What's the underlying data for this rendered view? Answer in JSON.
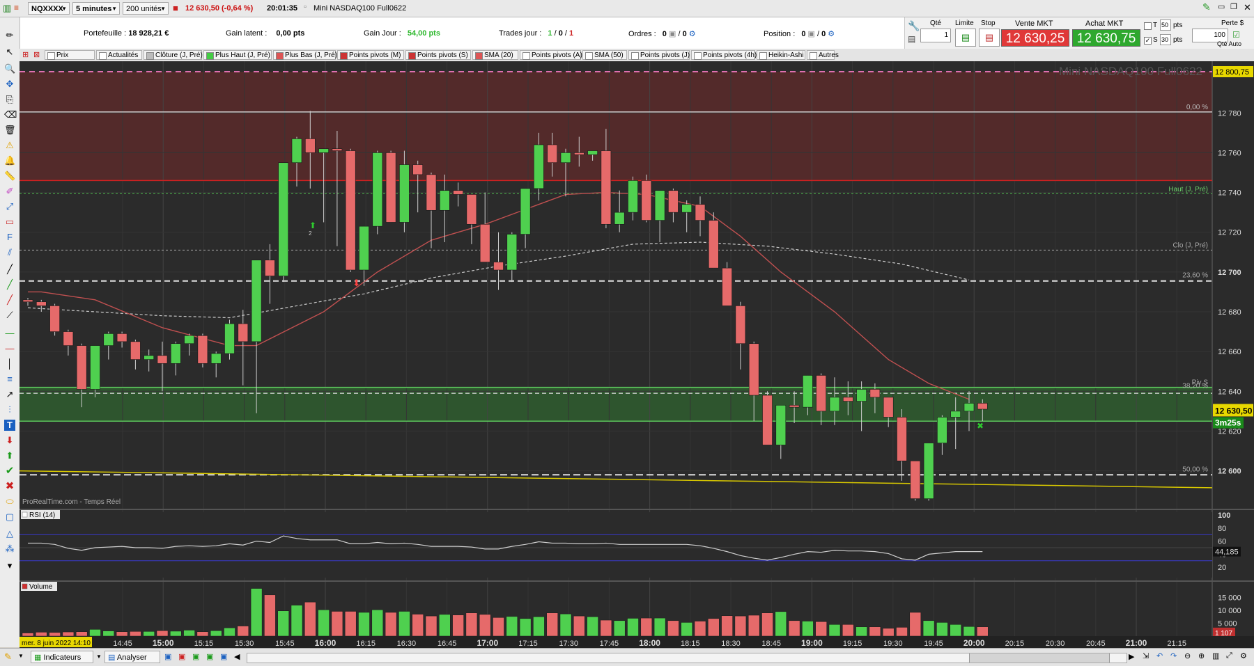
{
  "topbar": {
    "symbol": "NQXXXX",
    "timeframe": "5 minutes",
    "units": "200 unités",
    "price_change": "12 630,50 (-0,64 %)",
    "time": "20:01:35",
    "instrument": "Mini NASDAQ100 Full0622"
  },
  "info": {
    "portefeuille_label": "Portefeuille :",
    "portefeuille_value": "18 928,21 €",
    "gain_latent_label": "Gain latent :",
    "gain_latent_value": "0,00 pts",
    "gain_jour_label": "Gain Jour :",
    "gain_jour_value": "54,00 pts",
    "trades_label": "Trades jour :",
    "trades_a": "1",
    "trades_b": "0",
    "trades_c": "1",
    "ordres_label": "Ordres :",
    "ordres_a": "0",
    "ordres_b": "0",
    "position_label": "Position :",
    "position_a": "0",
    "position_b": "0"
  },
  "order": {
    "qte_label": "Qté",
    "qte_value": "1",
    "limite_label": "Limite",
    "stop_label": "Stop",
    "vente_label": "Vente MKT",
    "vente_price": "12 630,25",
    "achat_label": "Achat MKT",
    "achat_price": "12 630,75",
    "t_label": "T",
    "t_value": "50",
    "t_unit": "pts",
    "s_label": "S",
    "s_value": "30",
    "s_unit": "pts",
    "perte_label": "Perte $",
    "perte_value": "100",
    "qte_auto_label": "Qté Auto"
  },
  "indicators": [
    "Prix",
    "Actualités",
    "Clôture (J, Pré)",
    "Plus Haut (J, Pré)",
    "Plus Bas (J, Pré)",
    "Points pivots (M)",
    "Points pivots (S)",
    "SMA (20)",
    "Points pivots (A)",
    "SMA (50)",
    "Points pivots (J)",
    "Points pivots (4h)",
    "Heikin-Ashi",
    "Autres"
  ],
  "indicator_colors": [
    "#ffffff",
    "#ffffff",
    "#bbbbbb",
    "#44cc44",
    "#dd5555",
    "#cc3333",
    "#cc3333",
    "#dd5555",
    "#ffffff",
    "#ffffff",
    "#ffffff",
    "#ffffff",
    "#ffffff",
    "#ffffff"
  ],
  "chart": {
    "watermark": "Mini NASDAQ100 Full0622",
    "source": "ProRealTime.com - Temps Réel",
    "rsi_label": "RSI (14)",
    "volume_label": "Volume",
    "current_price": "12 630,50",
    "countdown": "3m25s",
    "top_price": "12 800,75",
    "rsi_value": "44,185",
    "volume_value": "1 107",
    "date_label": "mer. 8 juin 2022 14:10",
    "fib_labels": {
      "f0": "0,00 %",
      "f236": "23,60 %",
      "f382": "38,20 %",
      "f50": "50,00 %"
    },
    "level_labels": {
      "haut": "Haut (J, Pré)",
      "clo": "Clo (J, Pré)",
      "piv": "Piv S"
    },
    "marker_label": "2"
  },
  "chart_data": {
    "type": "candlestick",
    "y_ticks": [
      12780,
      12760,
      12740,
      12720,
      12700,
      12680,
      12660,
      12640,
      12620,
      12600
    ],
    "y_tick_labels": [
      "12 780",
      "12 760",
      "12 740",
      "12 720",
      "12 700",
      "12 680",
      "12 660",
      "12 640",
      "12 620",
      "12 600"
    ],
    "ylim": [
      12582,
      12806
    ],
    "x_tick_labels": [
      "14:45",
      "15:00",
      "15:15",
      "15:30",
      "15:45",
      "16:00",
      "16:15",
      "16:30",
      "16:45",
      "17:00",
      "17:15",
      "17:30",
      "17:45",
      "18:00",
      "18:15",
      "18:30",
      "18:45",
      "19:00",
      "19:15",
      "19:30",
      "19:45",
      "20:00",
      "20:15",
      "20:30",
      "20:45",
      "21:00",
      "21:15"
    ],
    "x_tick_bold": [
      "15:00",
      "16:00",
      "17:00",
      "18:00",
      "19:00",
      "20:00",
      "21:00"
    ],
    "candles": [
      [
        12686,
        12687,
        12683,
        12685
      ],
      [
        12685,
        12686,
        12680,
        12683
      ],
      [
        12683,
        12684,
        12668,
        12670
      ],
      [
        12670,
        12671,
        12658,
        12663
      ],
      [
        12663,
        12664,
        12632,
        12641
      ],
      [
        12641,
        12663,
        12637,
        12663
      ],
      [
        12663,
        12670,
        12656,
        12669
      ],
      [
        12669,
        12670,
        12662,
        12665
      ],
      [
        12665,
        12666,
        12651,
        12656
      ],
      [
        12656,
        12661,
        12650,
        12658
      ],
      [
        12658,
        12665,
        12640,
        12654
      ],
      [
        12654,
        12665,
        12648,
        12664
      ],
      [
        12664,
        12669,
        12658,
        12668
      ],
      [
        12668,
        12669,
        12652,
        12654
      ],
      [
        12654,
        12660,
        12647,
        12659
      ],
      [
        12659,
        12676,
        12656,
        12674
      ],
      [
        12674,
        12681,
        12643,
        12665
      ],
      [
        12665,
        12706,
        12629,
        12706
      ],
      [
        12706,
        12714,
        12684,
        12698
      ],
      [
        12698,
        12755,
        12695,
        12755
      ],
      [
        12755,
        12768,
        12743,
        12767
      ],
      [
        12767,
        12781,
        12742,
        12760
      ],
      [
        12760,
        12762,
        12725,
        12762
      ],
      [
        12762,
        12771,
        12713,
        12761
      ],
      [
        12761,
        12762,
        12700,
        12701
      ],
      [
        12701,
        12723,
        12693,
        12723
      ],
      [
        12723,
        12761,
        12719,
        12760
      ],
      [
        12760,
        12761,
        12725,
        12725
      ],
      [
        12725,
        12761,
        12720,
        12754
      ],
      [
        12754,
        12756,
        12730,
        12749
      ],
      [
        12749,
        12750,
        12712,
        12731
      ],
      [
        12731,
        12749,
        12715,
        12741
      ],
      [
        12741,
        12745,
        12733,
        12739
      ],
      [
        12739,
        12739,
        12714,
        12724
      ],
      [
        12724,
        12740,
        12710,
        12705
      ],
      [
        12705,
        12720,
        12691,
        12701
      ],
      [
        12701,
        12720,
        12695,
        12719
      ],
      [
        12719,
        12742,
        12712,
        12742
      ],
      [
        12742,
        12770,
        12736,
        12764
      ],
      [
        12764,
        12770,
        12748,
        12755
      ],
      [
        12755,
        12762,
        12738,
        12760
      ],
      [
        12760,
        12768,
        12753,
        12759
      ],
      [
        12759,
        12760,
        12756,
        12761
      ],
      [
        12761,
        12772,
        12722,
        12724
      ],
      [
        12724,
        12741,
        12720,
        12730
      ],
      [
        12730,
        12748,
        12726,
        12746
      ],
      [
        12746,
        12749,
        12725,
        12726
      ],
      [
        12726,
        12741,
        12715,
        12741
      ],
      [
        12741,
        12742,
        12725,
        12730
      ],
      [
        12730,
        12736,
        12720,
        12734
      ],
      [
        12734,
        12738,
        12718,
        12726
      ],
      [
        12726,
        12730,
        12702,
        12702
      ],
      [
        12702,
        12705,
        12684,
        12683
      ],
      [
        12683,
        12685,
        12651,
        12664
      ],
      [
        12664,
        12665,
        12625,
        12638
      ],
      [
        12638,
        12640,
        12619,
        12613
      ],
      [
        12613,
        12633,
        12606,
        12633
      ],
      [
        12633,
        12640,
        12624,
        12632
      ],
      [
        12632,
        12648,
        12628,
        12648
      ],
      [
        12648,
        12649,
        12623,
        12630
      ],
      [
        12630,
        12647,
        12623,
        12637
      ],
      [
        12637,
        12645,
        12628,
        12635
      ],
      [
        12635,
        12645,
        12620,
        12641
      ],
      [
        12641,
        12644,
        12629,
        12637
      ],
      [
        12637,
        12637,
        12622,
        12627
      ],
      [
        12627,
        12631,
        12595,
        12605
      ],
      [
        12605,
        12605,
        12585,
        12586
      ],
      [
        12586,
        12614,
        12585,
        12614
      ],
      [
        12614,
        12628,
        12608,
        12627
      ],
      [
        12627,
        12637,
        12611,
        12630
      ],
      [
        12630,
        12640,
        12620,
        12634
      ],
      [
        12634,
        12636,
        12625,
        12631
      ]
    ],
    "sma20": [
      [
        0,
        12690
      ],
      [
        1,
        12690
      ],
      [
        5,
        12686
      ],
      [
        10,
        12672
      ],
      [
        15,
        12663
      ],
      [
        17,
        12663
      ],
      [
        22,
        12680
      ],
      [
        26,
        12700
      ],
      [
        30,
        12716
      ],
      [
        34,
        12724
      ],
      [
        38,
        12734
      ],
      [
        40,
        12739
      ],
      [
        43,
        12740
      ],
      [
        46,
        12739
      ],
      [
        50,
        12733
      ],
      [
        53,
        12718
      ],
      [
        56,
        12700
      ],
      [
        60,
        12680
      ],
      [
        64,
        12656
      ],
      [
        67,
        12644
      ],
      [
        70,
        12636
      ]
    ],
    "sma50": [
      [
        0,
        12682
      ],
      [
        5,
        12680
      ],
      [
        10,
        12678
      ],
      [
        15,
        12677
      ],
      [
        20,
        12683
      ],
      [
        25,
        12689
      ],
      [
        30,
        12697
      ],
      [
        35,
        12703
      ],
      [
        40,
        12708
      ],
      [
        45,
        12714
      ],
      [
        50,
        12715
      ],
      [
        55,
        12713
      ],
      [
        60,
        12709
      ],
      [
        65,
        12704
      ],
      [
        70,
        12696
      ]
    ],
    "rsi": [
      57,
      57,
      55,
      49,
      46,
      50,
      51,
      52,
      50,
      50,
      49,
      52,
      53,
      52,
      53,
      56,
      54,
      60,
      58,
      68,
      64,
      62,
      62,
      62,
      56,
      56,
      58,
      56,
      57,
      55,
      52,
      52,
      52,
      51,
      48,
      48,
      52,
      55,
      59,
      57,
      57,
      56,
      56,
      57,
      55,
      55,
      55,
      55,
      55,
      55,
      53,
      49,
      44,
      38,
      34,
      31,
      35,
      40,
      44,
      43,
      46,
      45,
      45,
      44,
      41,
      33,
      31,
      40,
      42,
      44,
      44,
      44
    ],
    "rsi_ticks": [
      100,
      80,
      60,
      40,
      20
    ],
    "volume": [
      1200,
      1500,
      1400,
      1600,
      1700,
      2600,
      2000,
      1700,
      1800,
      1800,
      2100,
      1900,
      2300,
      1700,
      2100,
      3200,
      3900,
      18500,
      16000,
      9800,
      12000,
      13200,
      10200,
      9600,
      9600,
      9200,
      10200,
      9200,
      9600,
      8500,
      7800,
      8400,
      8200,
      9000,
      8400,
      7200,
      7600,
      6800,
      7500,
      9000,
      8600,
      7800,
      7500,
      6200,
      6000,
      6900,
      7000,
      7000,
      6000,
      5300,
      5800,
      6800,
      7900,
      7800,
      8100,
      9000,
      9500,
      6000,
      5800,
      5600,
      4500,
      4500,
      3600,
      3600,
      3000,
      3400,
      9200,
      6000,
      5300,
      4500,
      3700,
      3600
    ],
    "volume_ticks": [
      15000,
      10000,
      5000
    ],
    "volume_tick_labels": [
      "15 000",
      "10 000",
      "5 000"
    ]
  }
}
